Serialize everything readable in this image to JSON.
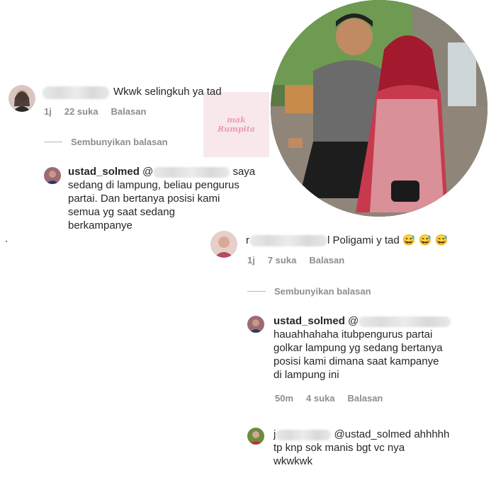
{
  "watermark": {
    "line1": "mak",
    "line2": "Rumpita"
  },
  "comment1": {
    "text": "Wkwk selingkuh ya tad",
    "meta": {
      "time": "1j",
      "likes": "22 suka",
      "reply": "Balasan"
    },
    "hide_replies": "Sembunyikan balasan"
  },
  "reply1": {
    "username": "ustad_solmed",
    "mention": "@",
    "text_line1": "saya",
    "text_line2": "sedang di lampung, beliau pengurus",
    "text_line3": "partai. Dan bertanya posisi kami",
    "text_line4": "semua yg saat sedang",
    "text_line5": "berkampanye"
  },
  "comment2": {
    "prefix": "r",
    "suffix": "l",
    "text": "Poligami y tad",
    "emojis": [
      "😅",
      "😅",
      "😅"
    ],
    "meta": {
      "time": "1j",
      "likes": "7 suka",
      "reply": "Balasan"
    },
    "hide_replies": "Sembunyikan balasan"
  },
  "reply2": {
    "username": "ustad_solmed",
    "mention": "@",
    "text_line1": "hauahhahaha itubpengurus partai",
    "text_line2": "golkar lampung yg sedang bertanya",
    "text_line3": "posisi kami dimana saat kampanye",
    "text_line4": "di lampung ini",
    "meta": {
      "time": "50m",
      "likes": "4 suka",
      "reply": "Balasan"
    }
  },
  "reply3": {
    "prefix": "j",
    "mention": "@ustad_solmed",
    "text_after": "ahhhhh",
    "text_line2": "tp knp sok manis bgt vc nya",
    "text_line3": "wkwkwk"
  },
  "colors": {
    "muted": "#8e8e8e",
    "text": "#262626",
    "watermark": "#e88aa0"
  }
}
